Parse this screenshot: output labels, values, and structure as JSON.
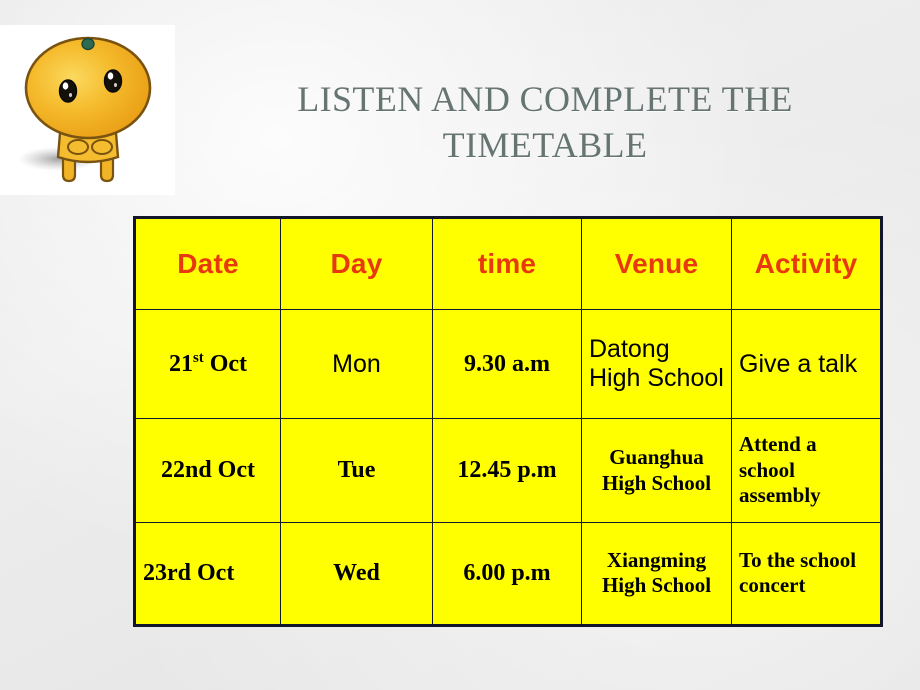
{
  "slide": {
    "title": "LISTEN AND COMPLETE THE TIMETABLE",
    "background_color": "#ebebeb",
    "title_color": "#667472"
  },
  "clipart": {
    "name": "cartoon-orange-character",
    "description": "Cartoon yellow-orange fruit character with two eyes and legs",
    "body_color": "#f0ab1e",
    "highlight_color": "#f7cf52",
    "outline_color": "#6b4a12",
    "stem_color": "#2f6b52",
    "box_color": "#ffffff"
  },
  "table": {
    "fill_color": "#ffff00",
    "border_color": "#14182c",
    "header_text_color": "#e8380d",
    "body_text_color": "#000000",
    "headers": [
      "Date",
      "Day",
      "time",
      "Venue",
      "Activity"
    ],
    "rows": [
      {
        "date_number": "21",
        "date_ordinal": "st",
        "date_month": " Oct",
        "day": "Mon",
        "time": "9.30 a.m",
        "venue": "Datong High School",
        "activity": "Give a talk"
      },
      {
        "date": "22nd Oct",
        "day": "Tue",
        "time": "12.45 p.m",
        "venue": "Guanghua High School",
        "activity": "Attend a school assembly"
      },
      {
        "date": "23rd Oct",
        "day": "Wed",
        "time": "6.00 p.m",
        "venue": "Xiangming High School",
        "activity": "To the school concert"
      }
    ]
  }
}
